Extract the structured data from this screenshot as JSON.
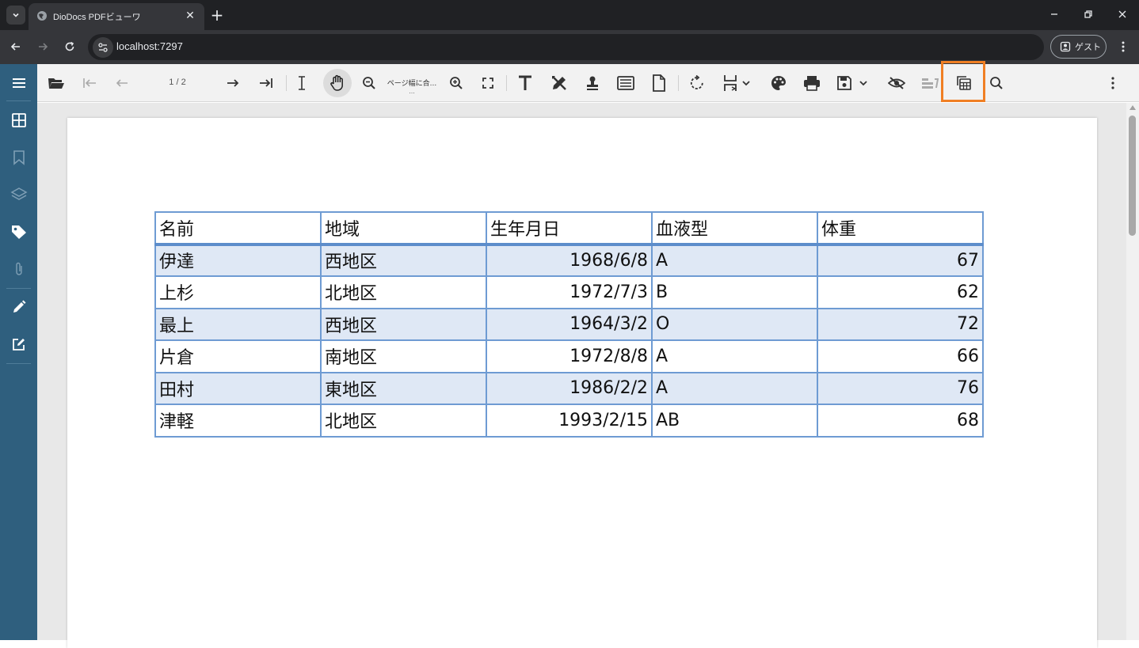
{
  "browser": {
    "tab_title": "DioDocs PDFビューワ",
    "url": "localhost:7297",
    "profile_label": "ゲスト"
  },
  "viewer": {
    "page_indicator": "1 / 2",
    "zoom_label": "ページ幅に合...",
    "zoom_ellipsis": "...",
    "highlighted_button": "table-extract-button",
    "highlight_color": "#f07f24",
    "sidebar_color": "#2f5f7e"
  },
  "table": {
    "headers": [
      "名前",
      "地域",
      "生年月日",
      "血液型",
      "体重"
    ],
    "rows": [
      [
        "伊達",
        "西地区",
        "1968/6/8",
        "A",
        "67"
      ],
      [
        "上杉",
        "北地区",
        "1972/7/3",
        "B",
        "62"
      ],
      [
        "最上",
        "西地区",
        "1964/3/2",
        "O",
        "72"
      ],
      [
        "片倉",
        "南地区",
        "1972/8/8",
        "A",
        "66"
      ],
      [
        "田村",
        "東地区",
        "1986/2/2",
        "A",
        "76"
      ],
      [
        "津軽",
        "北地区",
        "1993/2/15",
        "AB",
        "68"
      ]
    ]
  }
}
